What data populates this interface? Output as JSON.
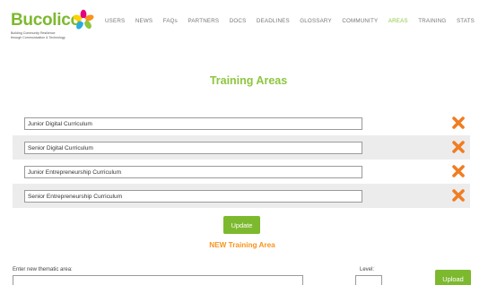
{
  "brand": {
    "name": "Bucolico",
    "tagline_line1": "Building Community Resilience",
    "tagline_line2": "through Communication & Technology"
  },
  "nav": {
    "items": [
      "USERS",
      "NEWS",
      "FAQs",
      "PARTNERS",
      "DOCS",
      "DEADLINES",
      "GLOSSARY",
      "COMMUNITY",
      "AREAS",
      "TRAINING",
      "STATS"
    ],
    "active": "AREAS"
  },
  "page": {
    "title": "Training Areas"
  },
  "areas": [
    {
      "value": "Junior Digital Curriculum"
    },
    {
      "value": "Senior Digital Curriculum"
    },
    {
      "value": "Junior Entrepreneurship Curriculum"
    },
    {
      "value": "Senior Entrepreneurship Curriculum"
    }
  ],
  "buttons": {
    "update": "Update",
    "upload": "Upload"
  },
  "new_area": {
    "title": "NEW Training Area",
    "thematic_label": "Enter new thematic area:",
    "thematic_value": "",
    "level_label": "Level:",
    "level_value": ""
  },
  "colors": {
    "brand_green": "#7db92e",
    "accent_orange": "#f7941d",
    "delete_orange": "#f07d22",
    "row_shade": "#ececec"
  },
  "icons": {
    "delete": "delete-x-icon",
    "logo": "flower-logo-icon"
  }
}
